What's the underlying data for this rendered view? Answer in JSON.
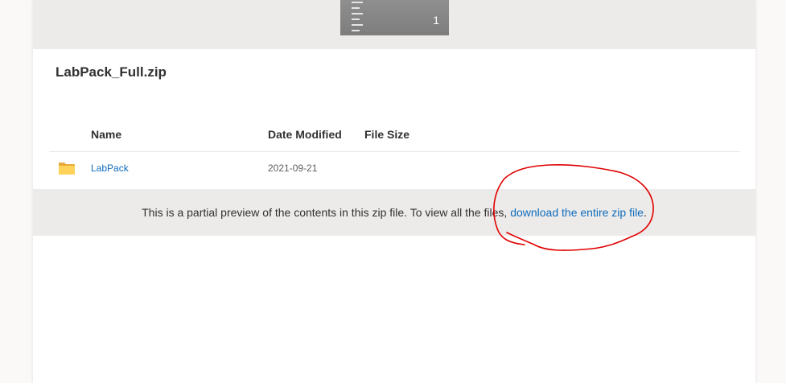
{
  "preview": {
    "page_number": "1"
  },
  "file": {
    "title": "LabPack_Full.zip"
  },
  "table": {
    "columns": {
      "name": "Name",
      "date_modified": "Date Modified",
      "file_size": "File Size"
    },
    "rows": [
      {
        "name": "LabPack",
        "date_modified": "2021-09-21",
        "file_size": "",
        "icon": "folder-icon"
      }
    ]
  },
  "notice": {
    "text": "This is a partial preview of the contents in this zip file. To view all the files, ",
    "link": "download the entire zip file",
    "suffix": "."
  },
  "colors": {
    "accent": "#0f6cbd",
    "band": "#edebe9",
    "annotation": "#e00000",
    "folder": "#ffd35a"
  },
  "annotation": {
    "shape": "hand-drawn red circle around download link"
  }
}
